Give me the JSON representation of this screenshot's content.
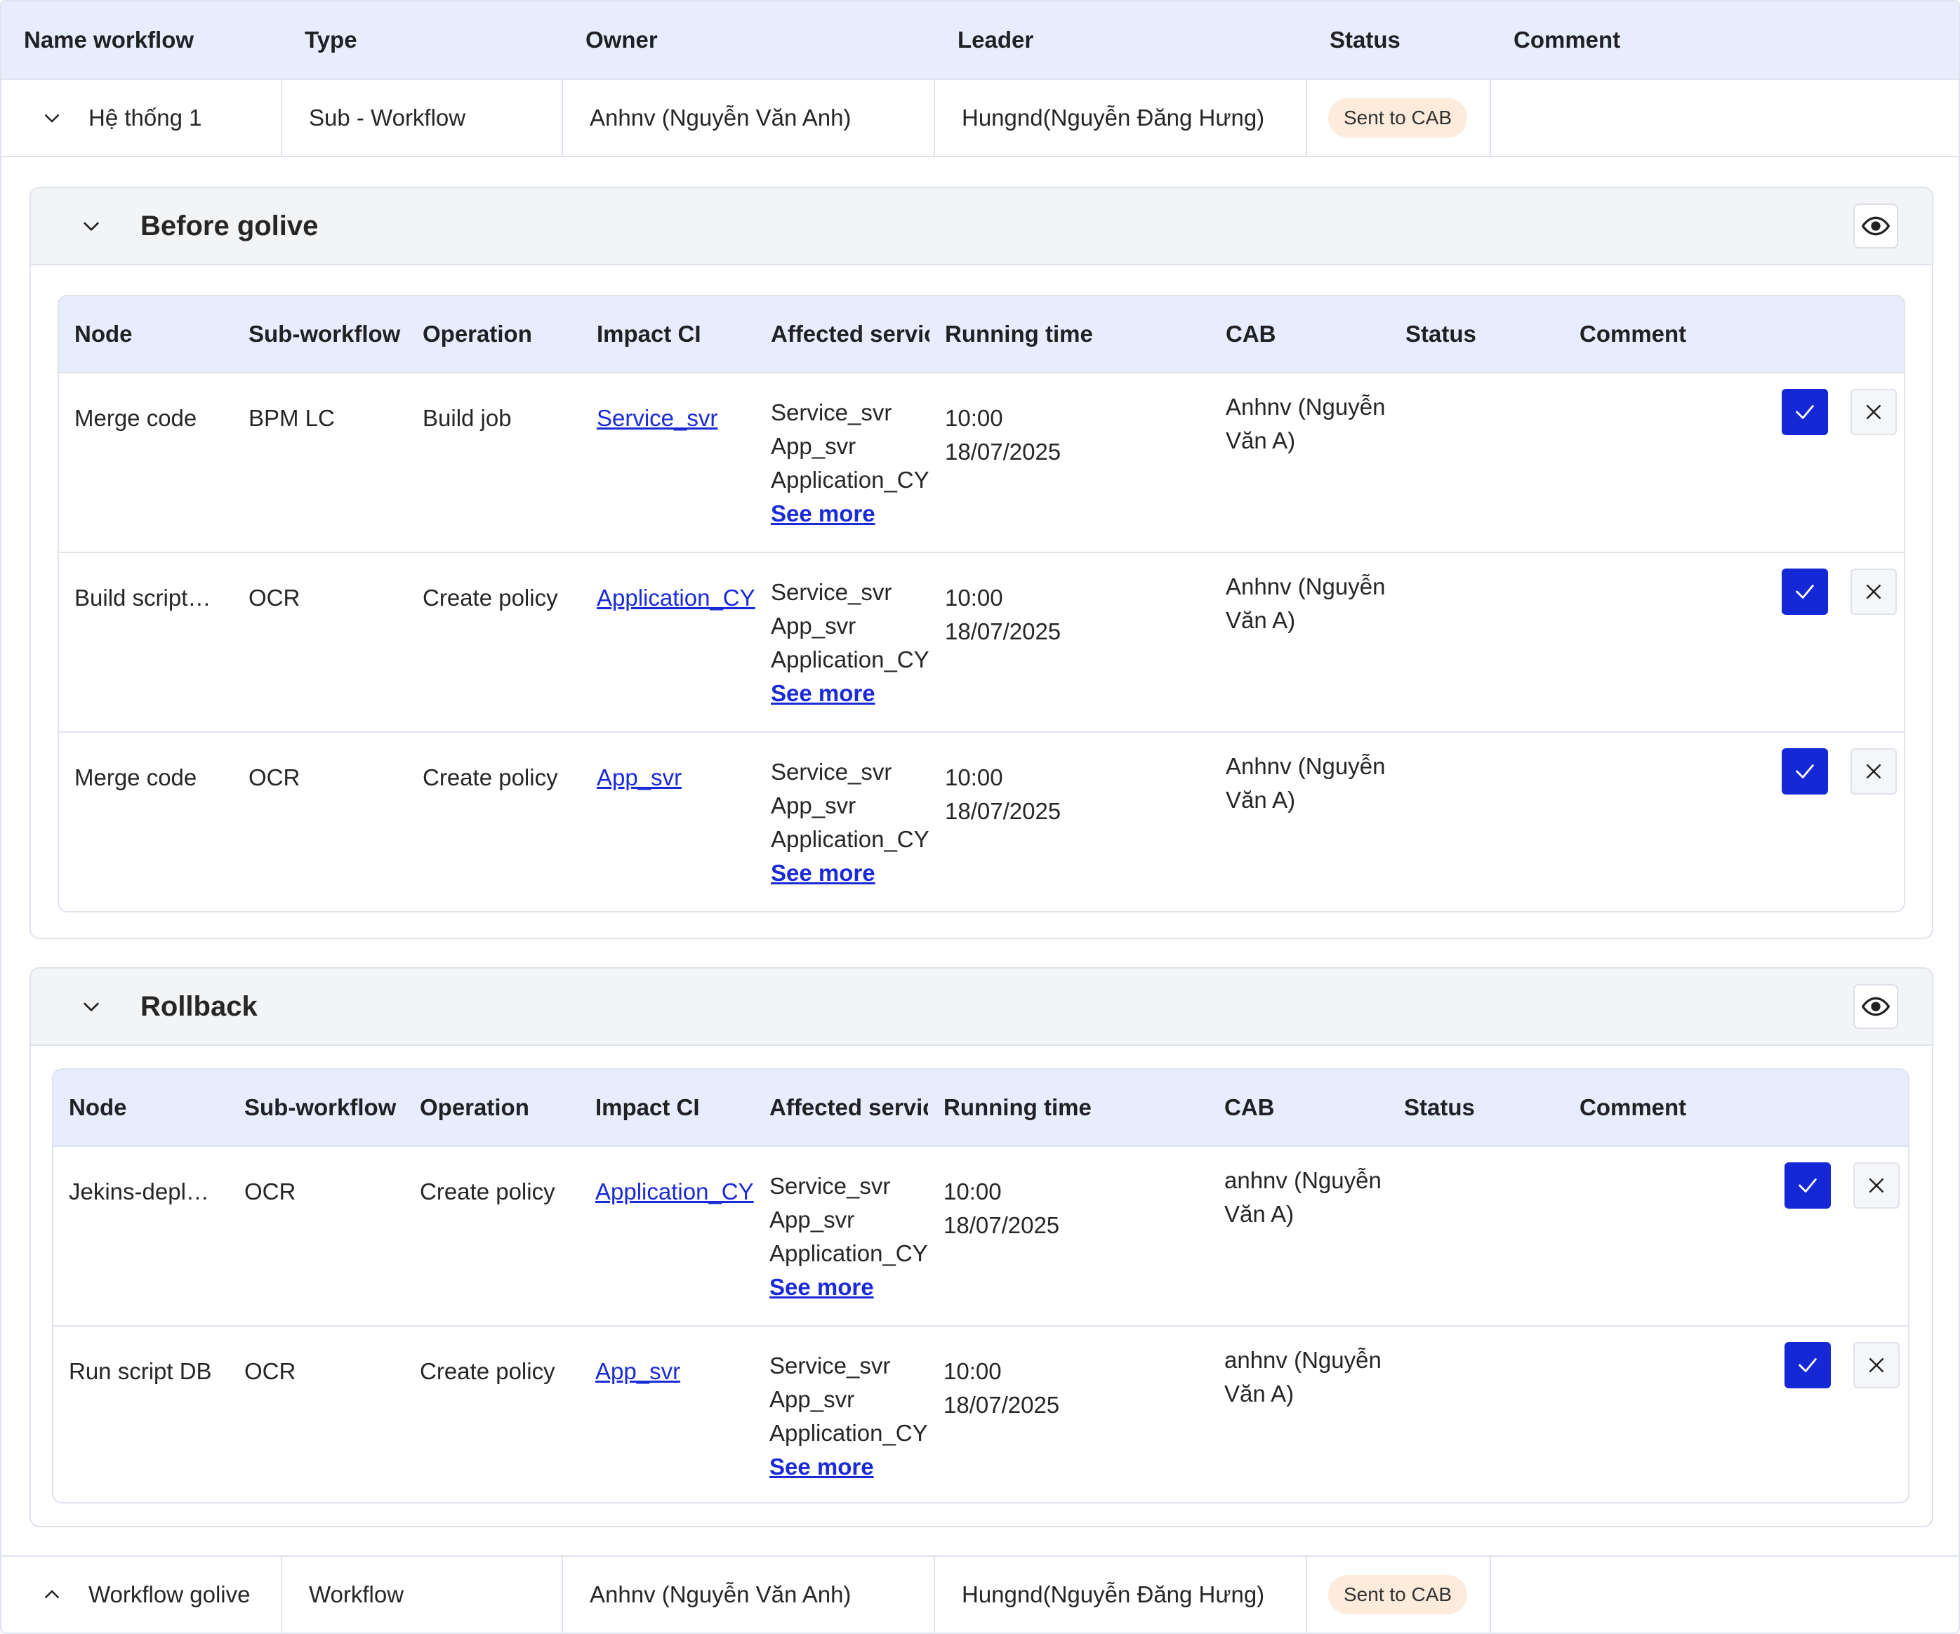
{
  "outer_table": {
    "columns": [
      "Name workflow",
      "Type",
      "Owner",
      "Leader",
      "Status",
      "Comment"
    ],
    "rows": [
      {
        "name": "Hệ thống 1",
        "type": "Sub - Workflow",
        "owner": "Anhnv (Nguyễn Văn Anh)",
        "leader": "Hungnd(Nguyễn Đăng Hưng)",
        "status": "Sent to CAB",
        "comment": "",
        "expanded": true
      },
      {
        "name": "Workflow golive",
        "type": "Workflow",
        "owner": "Anhnv (Nguyễn Văn Anh)",
        "leader": "Hungnd(Nguyễn Đăng Hưng)",
        "status": "Sent to CAB",
        "comment": "",
        "expanded": false
      }
    ]
  },
  "sections": [
    {
      "title": "Before golive",
      "columns": [
        "Node",
        "Sub-workflow",
        "Operation",
        "Impact CI",
        "Affected servic",
        "Running time",
        "CAB",
        "Status",
        "Comment"
      ],
      "rows": [
        {
          "node": "Merge code",
          "sub_workflow": "BPM LC",
          "operation": "Build job",
          "impact_ci": "Service_svr",
          "affected": [
            "Service_svr",
            "App_svr",
            "Application_CY"
          ],
          "see_more": "See more",
          "time": "10:00",
          "date": "18/07/2025",
          "cab": "Anhnv (Nguyễn Văn A)",
          "status": "",
          "comment": ""
        },
        {
          "node": "Build script…",
          "sub_workflow": "OCR",
          "operation": "Create policy",
          "impact_ci": "Application_CY",
          "affected": [
            "Service_svr",
            "App_svr",
            "Application_CY"
          ],
          "see_more": "See more",
          "time": "10:00",
          "date": "18/07/2025",
          "cab": "Anhnv (Nguyễn Văn A)",
          "status": "",
          "comment": ""
        },
        {
          "node": "Merge code",
          "sub_workflow": "OCR",
          "operation": "Create policy",
          "impact_ci": "App_svr",
          "affected": [
            "Service_svr",
            "App_svr",
            "Application_CY"
          ],
          "see_more": "See more",
          "time": "10:00",
          "date": "18/07/2025",
          "cab": "Anhnv (Nguyễn Văn A)",
          "status": "",
          "comment": ""
        }
      ]
    },
    {
      "title": "Rollback",
      "columns": [
        "Node",
        "Sub-workflow",
        "Operation",
        "Impact CI",
        "Affected servic",
        "Running time",
        "CAB",
        "Status",
        "Comment"
      ],
      "rows": [
        {
          "node": "Jekins-depl…",
          "sub_workflow": "OCR",
          "operation": "Create policy",
          "impact_ci": "Application_CY",
          "affected": [
            "Service_svr",
            "App_svr",
            "Application_CY"
          ],
          "see_more": "See more",
          "time": "10:00",
          "date": "18/07/2025",
          "cab": "anhnv (Nguyễn Văn A)",
          "status": "",
          "comment": ""
        },
        {
          "node": "Run script DB",
          "sub_workflow": "OCR",
          "operation": "Create policy",
          "impact_ci": "App_svr",
          "affected": [
            "Service_svr",
            "App_svr",
            "Application_CY"
          ],
          "see_more": "See more",
          "time": "10:00",
          "date": "18/07/2025",
          "cab": "anhnv (Nguyễn Văn A)",
          "status": "",
          "comment": ""
        }
      ]
    }
  ],
  "icons": {
    "expand": "chevron-down-icon",
    "collapse": "chevron-up-icon",
    "view": "eye-icon",
    "approve": "check-icon",
    "reject": "close-icon"
  },
  "colors": {
    "header_bg": "#e8edfe",
    "section_head_bg": "#f3f4f6",
    "primary": "#1428d6",
    "link": "#1a2bd6",
    "status_pill_bg": "#fdebdc",
    "border": "#dfe3ec"
  }
}
